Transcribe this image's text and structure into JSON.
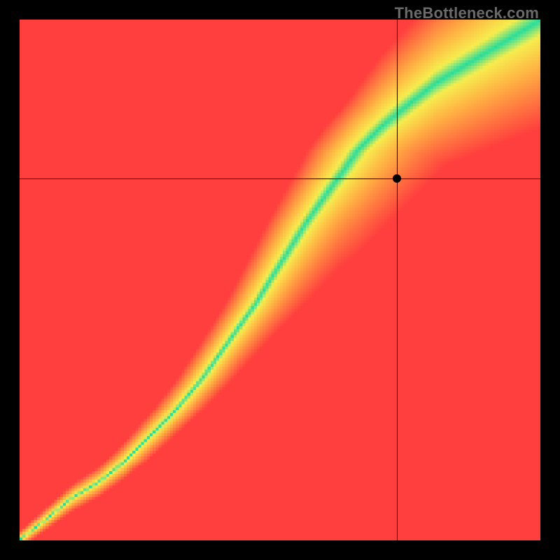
{
  "branding": {
    "watermark": "TheBottleneck.com"
  },
  "chart_data": {
    "type": "heatmap",
    "title": "",
    "xlabel": "",
    "ylabel": "",
    "xlim": [
      0,
      1
    ],
    "ylim": [
      0,
      1
    ],
    "crosshair": {
      "x": 0.725,
      "y": 0.695
    },
    "marker": {
      "x": 0.725,
      "y": 0.695
    },
    "watermark": "TheBottleneck.com",
    "optimal_curve": {
      "description": "Green optimal band center (normalized x→y)",
      "x": [
        0.0,
        0.05,
        0.1,
        0.15,
        0.2,
        0.25,
        0.3,
        0.35,
        0.4,
        0.45,
        0.5,
        0.55,
        0.6,
        0.65,
        0.7,
        0.75,
        0.8,
        0.85,
        0.9,
        0.95,
        1.0
      ],
      "y": [
        0.0,
        0.04,
        0.08,
        0.11,
        0.15,
        0.2,
        0.25,
        0.31,
        0.38,
        0.45,
        0.53,
        0.61,
        0.68,
        0.75,
        0.8,
        0.84,
        0.88,
        0.91,
        0.94,
        0.97,
        1.0
      ]
    },
    "band_width": {
      "description": "Approx. half-width of green band in y-units as a function of y",
      "y": [
        0.0,
        0.1,
        0.2,
        0.3,
        0.4,
        0.5,
        0.6,
        0.7,
        0.8,
        0.9,
        1.0
      ],
      "half": [
        0.005,
        0.01,
        0.015,
        0.018,
        0.022,
        0.028,
        0.035,
        0.045,
        0.06,
        0.075,
        0.09
      ]
    },
    "colors": {
      "optimal": "#27dd9c",
      "near": "#f6ed4e",
      "mid": "#ffb343",
      "far": "#ff3e3e"
    },
    "resolution": 180,
    "notes": "Heatmap depicts bottleneck severity: green=balanced pairing along a superlinear curve, transitioning through yellow→orange→red as pairing becomes unbalanced. Crosshair + dot mark a specific CPU/GPU selection."
  }
}
